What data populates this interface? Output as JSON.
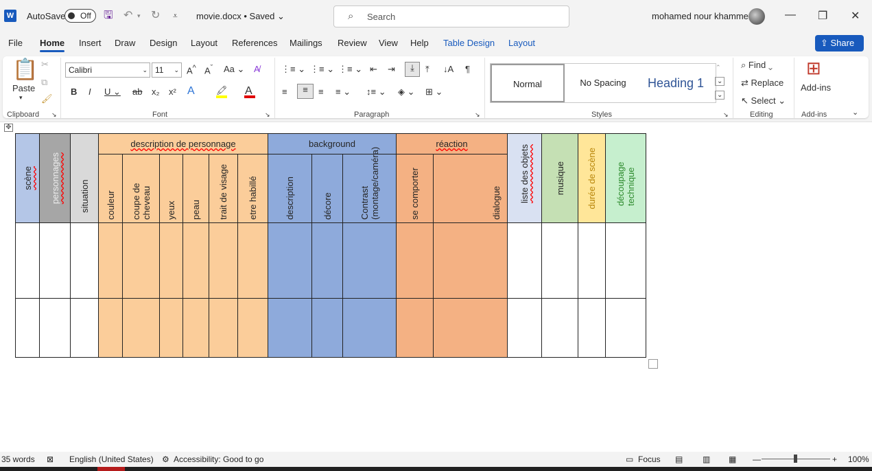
{
  "titlebar": {
    "app_logo": "W",
    "autosave_label": "AutoSave",
    "autosave_state": "Off",
    "doc_title": "movie.docx • Saved",
    "search_placeholder": "Search",
    "user_name": "mohamed nour khammeri",
    "icons": [
      "save-icon",
      "undo-icon",
      "redo-icon",
      "customize-qat-icon",
      "search-icon",
      "minimize-icon",
      "restore-icon",
      "close-icon"
    ]
  },
  "menu": {
    "tabs": [
      "File",
      "Home",
      "Insert",
      "Draw",
      "Design",
      "Layout",
      "References",
      "Mailings",
      "Review",
      "View",
      "Help"
    ],
    "contextual_tabs": [
      "Table Design",
      "Layout"
    ],
    "active_tab": "Home",
    "share_label": "Share"
  },
  "ribbon": {
    "clipboard": {
      "label": "Clipboard",
      "paste_label": "Paste"
    },
    "font": {
      "label": "Font",
      "family": "Calibri",
      "size": "11",
      "font_color": "#e00000",
      "highlight_color": "#ffff00"
    },
    "paragraph": {
      "label": "Paragraph"
    },
    "styles": {
      "label": "Styles",
      "items": [
        "Normal",
        "No Spacing",
        "Heading 1"
      ],
      "selected": "Normal",
      "heading_color": "#2f5496"
    },
    "editing": {
      "label": "Editing",
      "find": "Find",
      "replace": "Replace",
      "select": "Select"
    },
    "addins": {
      "label": "Add-ins",
      "button": "Add-ins"
    }
  },
  "table": {
    "colors": {
      "scene": "#b4c6e7",
      "personnages": "#a6a6a6",
      "situation": "#d9d9d9",
      "description_personnage": "#fbcd9a",
      "background": "#8eaadb",
      "reaction": "#f4b183",
      "objets": "#d9e1f2",
      "musique": "#c5e0b4",
      "duree": "#ffe699",
      "decoupage": "#c6efce"
    },
    "headers": {
      "scene": "scène",
      "personnages": "personnages",
      "situation": "situation",
      "description_personnage": "description de personnage",
      "background": "background",
      "reaction": "réaction",
      "objets": "liste des objets",
      "musique": "musique",
      "duree": "durée de scène",
      "decoupage": "découpage technique"
    },
    "sub_headers": {
      "description_personnage": [
        "couleur",
        "coupe de cheveau",
        "yeux",
        "peau",
        "trait de visage",
        "etre habillé"
      ],
      "background": [
        "description",
        "décore",
        "Contrast (montage/caméra)"
      ],
      "reaction": [
        "se comporter",
        "dialogue"
      ]
    }
  },
  "status": {
    "words": "35 words",
    "language": "English (United States)",
    "accessibility": "Accessibility: Good to go",
    "focus": "Focus",
    "zoom": "100%"
  }
}
